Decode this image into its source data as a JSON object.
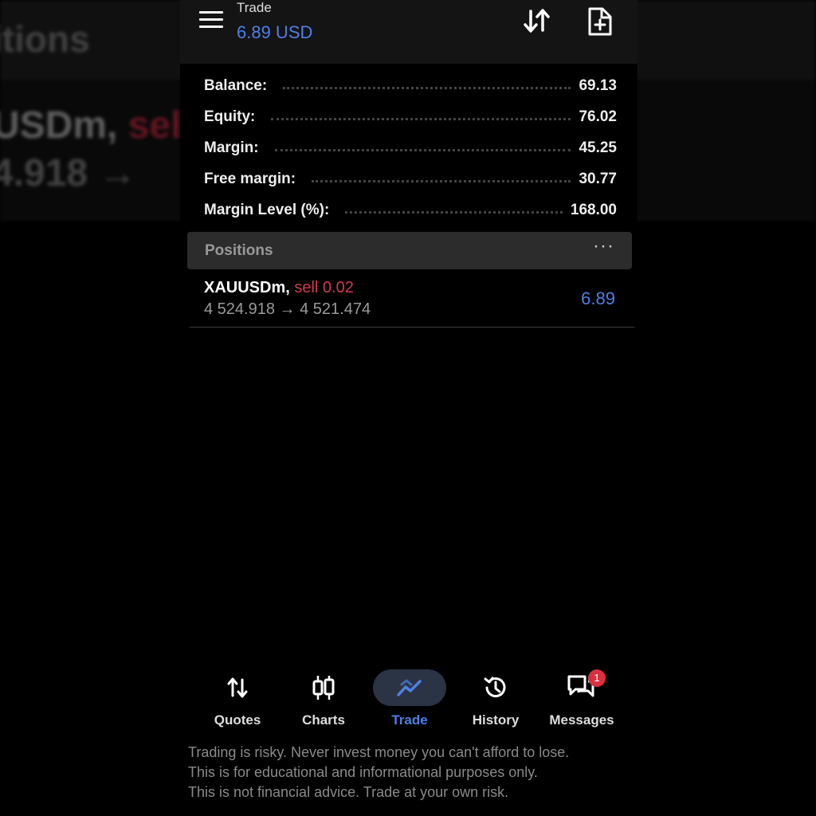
{
  "background": {
    "title": "itions",
    "symbol": "USDm,",
    "side": "sell",
    "price": "4.918 →"
  },
  "topbar": {
    "title": "Trade",
    "subtitle": "6.89 USD",
    "icons": [
      "menu-icon",
      "sort-icon",
      "new-order-icon"
    ]
  },
  "account": {
    "balance": {
      "label": "Balance:",
      "value": "69.13"
    },
    "equity": {
      "label": "Equity:",
      "value": "76.02"
    },
    "margin": {
      "label": "Margin:",
      "value": "45.25"
    },
    "free_margin": {
      "label": "Free margin:",
      "value": "30.77"
    },
    "margin_level": {
      "label": "Margin Level (%):",
      "value": "168.00"
    }
  },
  "positions": {
    "header": "Positions",
    "more": "···",
    "items": [
      {
        "symbol": "XAUUSDm,",
        "side": "sell 0.02",
        "open_price": "4 524.918",
        "arrow": "→",
        "current_price": "4 521.474",
        "profit": "6.89"
      }
    ]
  },
  "nav": {
    "quotes": "Quotes",
    "charts": "Charts",
    "trade": "Trade",
    "history": "History",
    "messages": "Messages",
    "messages_badge": "1",
    "active": "Trade"
  },
  "disclaimer": {
    "line1": "Trading is risky. Never invest money you can't afford to lose.",
    "line2": "This is for educational and informational purposes only.",
    "line3": "This is not financial advice. Trade at your own risk."
  },
  "colors": {
    "accent": "#4f7fe6",
    "sell": "#d23a4e",
    "badge": "#d93040"
  }
}
